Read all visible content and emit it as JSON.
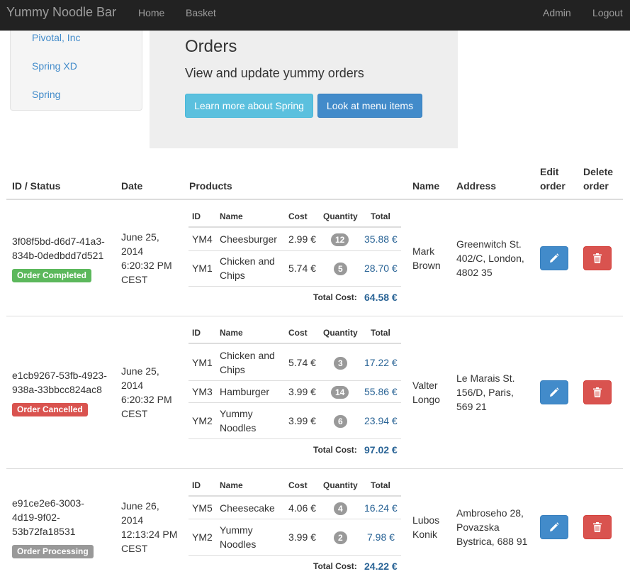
{
  "navbar": {
    "brand": "Yummy Noodle Bar",
    "links": [
      "Home",
      "Basket"
    ],
    "right_links": [
      "Admin",
      "Logout"
    ]
  },
  "sidebar": {
    "items": [
      "Pivotal, Inc",
      "Spring XD",
      "Spring"
    ]
  },
  "jumbotron": {
    "title": "Orders",
    "lead": "View and update yummy orders",
    "buttons": [
      "Learn more about Spring",
      "Look at menu items"
    ]
  },
  "table": {
    "headers": {
      "id_status": "ID / Status",
      "date": "Date",
      "products": "Products",
      "name": "Name",
      "address": "Address",
      "edit_1": "Edit",
      "edit_2": "order",
      "delete_1": "Delete",
      "delete_2": "order"
    },
    "product_headers": [
      "ID",
      "Name",
      "Cost",
      "Quantity",
      "Total"
    ],
    "total_cost_label": "Total Cost:",
    "orders": [
      {
        "id_lines": [
          "3f08f5bd-d6d7-41a3-",
          "834b-0dedbdd7d521"
        ],
        "status": "Order Completed",
        "date_lines": [
          "June 25,",
          "2014",
          "6:20:32 PM",
          "CEST"
        ],
        "products": [
          {
            "id": "YM4",
            "name_lines": [
              "Cheesburger"
            ],
            "cost": "2.99 €",
            "quantity": "12",
            "total": "35.88 €"
          },
          {
            "id": "YM1",
            "name_lines": [
              "Chicken and",
              "Chips"
            ],
            "cost": "5.74 €",
            "quantity": "5",
            "total": "28.70 €"
          }
        ],
        "total_cost": "64.58 €",
        "name_lines": [
          "Mark",
          "Brown"
        ],
        "address_lines": [
          "Greenwitch St.",
          "402/C, London,",
          "4802 35"
        ]
      },
      {
        "id_lines": [
          "e1cb9267-53fb-4923-",
          "938a-33bbcc824ac8"
        ],
        "status": "Order Cancelled",
        "date_lines": [
          "June 25,",
          "2014",
          "6:20:32 PM",
          "CEST"
        ],
        "products": [
          {
            "id": "YM1",
            "name_lines": [
              "Chicken and",
              "Chips"
            ],
            "cost": "5.74 €",
            "quantity": "3",
            "total": "17.22 €"
          },
          {
            "id": "YM3",
            "name_lines": [
              "Hamburger"
            ],
            "cost": "3.99 €",
            "quantity": "14",
            "total": "55.86 €"
          },
          {
            "id": "YM2",
            "name_lines": [
              "Yummy",
              "Noodles"
            ],
            "cost": "3.99 €",
            "quantity": "6",
            "total": "23.94 €"
          }
        ],
        "total_cost": "97.02 €",
        "name_lines": [
          "Valter",
          "Longo"
        ],
        "address_lines": [
          "Le Marais St.",
          "156/D, Paris,",
          "569 21"
        ]
      },
      {
        "id_lines": [
          "e91ce2e6-3003-",
          "4d19-9f02-",
          "53b72fa18531"
        ],
        "status": "Order Processing",
        "date_lines": [
          "June 26,",
          "2014",
          "12:13:24 PM",
          "CEST"
        ],
        "products": [
          {
            "id": "YM5",
            "name_lines": [
              "Cheesecake"
            ],
            "cost": "4.06 €",
            "quantity": "4",
            "total": "16.24 €"
          },
          {
            "id": "YM2",
            "name_lines": [
              "Yummy",
              "Noodles"
            ],
            "cost": "3.99 €",
            "quantity": "2",
            "total": "7.98 €"
          }
        ],
        "total_cost": "24.22 €",
        "name_lines": [
          "Lubos",
          "Konik"
        ],
        "address_lines": [
          "Ambroseho 28,",
          "Povazska",
          "Bystrica, 688 91"
        ]
      }
    ]
  },
  "colors": {
    "navbar_bg": "#222222",
    "link": "#428bca",
    "success": "#5cb85c",
    "danger": "#d9534f",
    "default": "#999999",
    "primary": "#428bca",
    "info": "#5bc0de"
  },
  "icons": {
    "edit": "pencil-icon",
    "delete": "trash-icon"
  }
}
